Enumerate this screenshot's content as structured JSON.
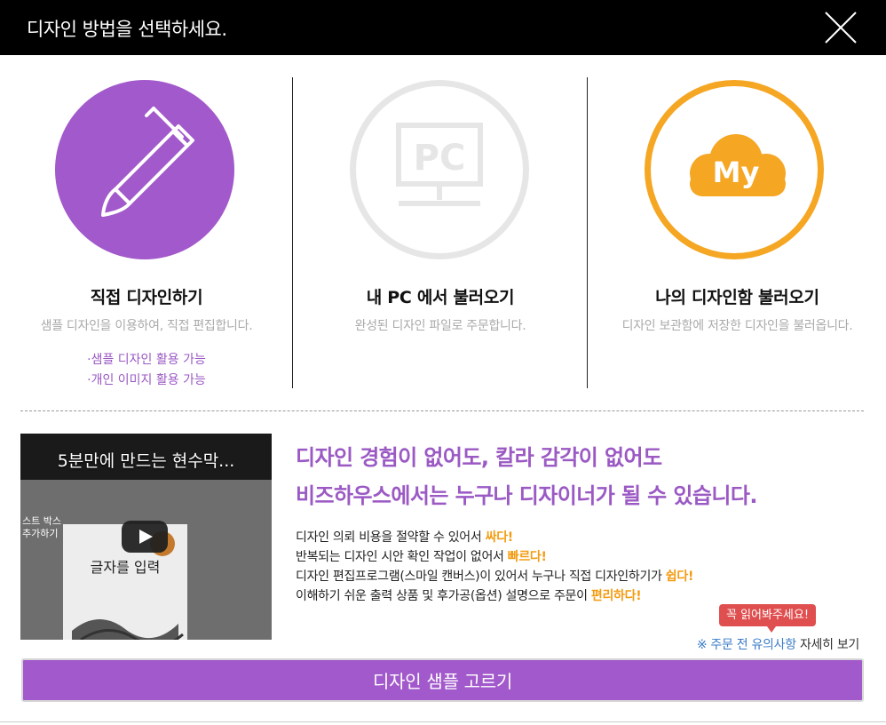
{
  "header": {
    "title": "디자인 방법을 선택하세요."
  },
  "options": [
    {
      "icon": "brush-icon",
      "title": "직접 디자인하기",
      "desc": "샘플 디자인을 이용하여, 직접 편집합니다.",
      "features": [
        "·샘플 디자인 활용 가능",
        "·개인 이미지 활용 가능"
      ]
    },
    {
      "icon": "pc-monitor-icon",
      "title": "내 PC 에서 불러오기",
      "desc": "완성된 디자인 파일로 주문합니다.",
      "icon_text": "PC"
    },
    {
      "icon": "cloud-icon",
      "title": "나의 디자인함 불러오기",
      "desc": "디자인 보관함에 저장한 디자인을 불러옵니다.",
      "icon_text": "My"
    }
  ],
  "video": {
    "title": "5분만에 만드는 현수막...",
    "side_text": [
      "스트 박스",
      "추가하기"
    ],
    "paper_text": "글자를 입력"
  },
  "promo": {
    "headline_1": "디자인 경험이 없어도, 칼라 감각이 없어도",
    "headline_2": "비즈하우스에서는 누구나 디자이너가 될 수 있습니다.",
    "benefits": [
      {
        "text": "디자인 의뢰 비용을 절약할 수 있어서 ",
        "accent": "싸다!"
      },
      {
        "text": "반복되는 디자인 시안 확인 작업이 없어서 ",
        "accent": "빠르다!"
      },
      {
        "text": "디자인 편집프로그램(스마일 캔버스)이 있어서 누구나 직접 디자인하기가 ",
        "accent": "쉽다!"
      },
      {
        "text": "이해하기 쉬운 출력 상품 및 후가공(옵션) 설명으로 주문이 ",
        "accent": "편리하다!"
      }
    ]
  },
  "tooltip": "꼭 읽어봐주세요!",
  "notice": {
    "link": "※ 주문 전 유의사항",
    "suffix": " 자세히 보기"
  },
  "button": {
    "label": "디자인 샘플 고르기"
  },
  "colors": {
    "purple": "#a259cb",
    "orange": "#f5a623",
    "gray": "#e6e6e6"
  }
}
